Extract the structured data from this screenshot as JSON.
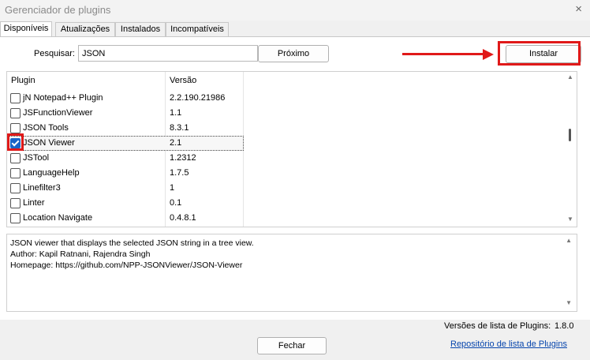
{
  "window": {
    "title": "Gerenciador de plugins",
    "close_icon": "×"
  },
  "tabs": [
    {
      "label": "Disponíveis"
    },
    {
      "label": "Atualizações"
    },
    {
      "label": "Instalados"
    },
    {
      "label": "Incompatíveis"
    }
  ],
  "search": {
    "label": "Pesquisar:",
    "value": "JSON",
    "next_button": "Próximo"
  },
  "actions": {
    "install_button": "Instalar",
    "close_button": "Fechar"
  },
  "list": {
    "columns": [
      "Plugin",
      "Versão"
    ],
    "rows": [
      {
        "name": "jN Notepad++ Plugin",
        "version": "2.2.190.21986",
        "checked": false
      },
      {
        "name": "JSFunctionViewer",
        "version": "1.1",
        "checked": false
      },
      {
        "name": "JSON Tools",
        "version": "8.3.1",
        "checked": false
      },
      {
        "name": "JSON Viewer",
        "version": "2.1",
        "checked": true
      },
      {
        "name": "JSTool",
        "version": "1.2312",
        "checked": false
      },
      {
        "name": "LanguageHelp",
        "version": "1.7.5",
        "checked": false
      },
      {
        "name": "Linefilter3",
        "version": "1",
        "checked": false
      },
      {
        "name": "Linter",
        "version": "0.1",
        "checked": false
      },
      {
        "name": "Location Navigate",
        "version": "0.4.8.1",
        "checked": false
      }
    ]
  },
  "description": {
    "lines": [
      "JSON viewer that displays the selected JSON string in a tree view.",
      "Author: Kapil Ratnani, Rajendra Singh",
      "Homepage: https://github.com/NPP-JSONViewer/JSON-Viewer"
    ]
  },
  "footer": {
    "list_version_label": "Versões de lista de Plugins:",
    "list_version_value": "1.8.0",
    "repo_link": "Repositório de lista de Plugins"
  },
  "annotation_color": "#e01919"
}
